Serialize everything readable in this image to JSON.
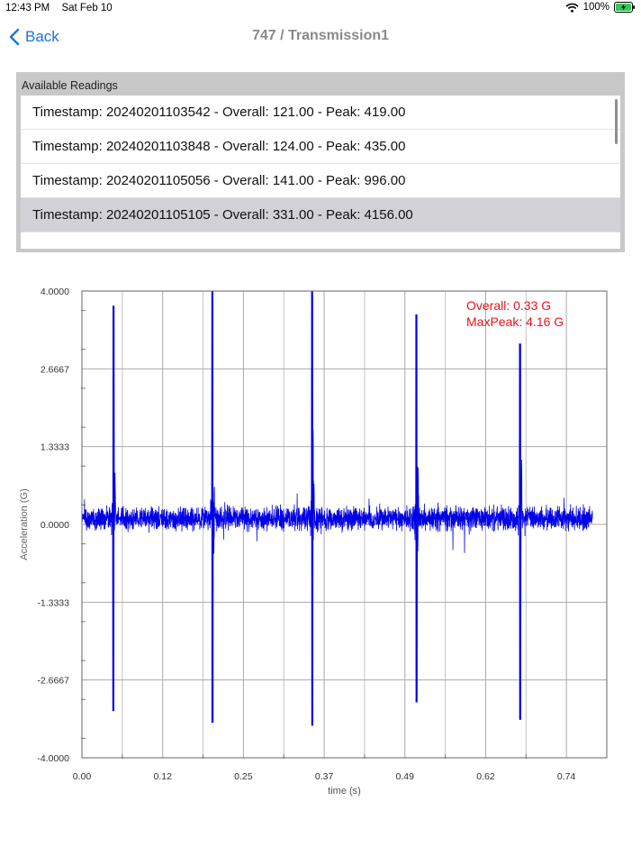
{
  "status_bar": {
    "time": "12:43 PM",
    "date": "Sat Feb 10",
    "battery": "100%"
  },
  "nav": {
    "back_label": "Back",
    "title": "747 / Transmission1"
  },
  "readings": {
    "header": "Available Readings",
    "items": [
      "Timestamp: 20240201103542 - Overall: 121.00 - Peak: 419.00",
      "Timestamp: 20240201103848 - Overall: 124.00 - Peak: 435.00",
      "Timestamp: 20240201105056 - Overall: 141.00 - Peak: 996.00",
      "Timestamp: 20240201105105 - Overall: 331.00 - Peak: 4156.00"
    ],
    "selected_index": 3
  },
  "chart_data": {
    "type": "line",
    "xlabel": "time (s)",
    "ylabel": "Acceleration (G)",
    "xlim": [
      0.0,
      0.8
    ],
    "ylim": [
      -4.0,
      4.0
    ],
    "x_ticks": [
      "0.00",
      "0.12",
      "0.25",
      "0.37",
      "0.49",
      "0.62",
      "0.74"
    ],
    "y_ticks": [
      "4.0000",
      "2.6667",
      "1.3333",
      "0.0000",
      "-1.3333",
      "-2.6667",
      "-4.0000"
    ],
    "grid": true,
    "annotations": [
      "Overall: 0.33 G",
      "MaxPeak: 4.16 G"
    ],
    "annotation_color": "#e8131b",
    "series": [
      {
        "color": "#0000e6",
        "baseline": 0.1,
        "noise_amplitude": 0.18,
        "impulses": [
          {
            "t": 0.048,
            "max": 3.75,
            "min": -3.2
          },
          {
            "t": 0.199,
            "max": 4.0,
            "min": -3.4
          },
          {
            "t": 0.351,
            "max": 4.0,
            "min": -3.45
          },
          {
            "t": 0.51,
            "max": 3.6,
            "min": -3.05
          },
          {
            "t": 0.668,
            "max": 3.1,
            "min": -3.35
          }
        ]
      }
    ]
  }
}
